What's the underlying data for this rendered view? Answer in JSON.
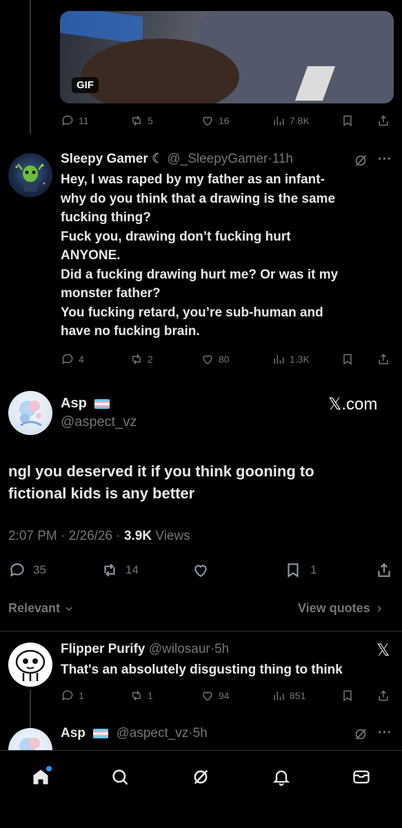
{
  "top_tweet": {
    "media_badge": "GIF",
    "stats": {
      "replies": "11",
      "reposts": "5",
      "likes": "16",
      "views": "7.8K"
    }
  },
  "reply1": {
    "display_name": "Sleepy Gamer ☾",
    "handle": "@_SleepyGamer",
    "time": "11h",
    "text": "Hey, I was raped by my father as an infant-\nwhy do you think that a drawing is the same\nfucking thing?\nFuck you, drawing don’t fucking hurt\nANYONE.\nDid a fucking drawing hurt me? Or was it my\nmonster father?\nYou fucking retard, you’re sub-human and\nhave no fucking brain.",
    "stats": {
      "replies": "4",
      "reposts": "2",
      "likes": "80",
      "views": "1.3K"
    }
  },
  "main_tweet": {
    "display_name": "Asp",
    "handle": "@aspect_vz",
    "brand": "𝕏.com",
    "text": "ngl you deserved it if you think gooning to\nfictional kids is any better",
    "time": "2:07 PM",
    "date": "2/26/26",
    "views_count": "3.9K",
    "views_label": "Views",
    "stats": {
      "replies": "35",
      "reposts": "14",
      "bookmarks": "1"
    }
  },
  "filters": {
    "sort_label": "Relevant",
    "quotes_label": "View quotes"
  },
  "reply2": {
    "display_name": "Flipper Purify",
    "handle": "@wilosaur",
    "time": "5h",
    "text": "That's an absolutely disgusting thing to think",
    "stats": {
      "replies": "1",
      "reposts": "1",
      "likes": "94",
      "views": "851"
    }
  },
  "reply3": {
    "display_name": "Asp",
    "handle": "@aspect_vz",
    "time": "5h"
  },
  "colors": {
    "background": "#000000",
    "text": "#e7e9ea",
    "muted": "#71767b",
    "accent": "#1d9bf0"
  },
  "nav": [
    "home-icon",
    "search-icon",
    "grok-icon",
    "notifications-icon",
    "messages-icon"
  ]
}
